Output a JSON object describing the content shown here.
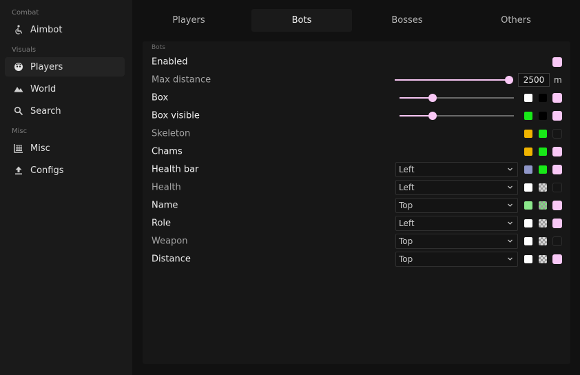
{
  "sidebar": {
    "sections": [
      {
        "label": "Combat",
        "items": [
          {
            "label": "Aimbot",
            "icon": "aimbot-icon",
            "active": false
          }
        ]
      },
      {
        "label": "Visuals",
        "items": [
          {
            "label": "Players",
            "icon": "players-icon",
            "active": true
          },
          {
            "label": "World",
            "icon": "world-icon",
            "active": false
          },
          {
            "label": "Search",
            "icon": "search-icon",
            "active": false
          }
        ]
      },
      {
        "label": "Misc",
        "items": [
          {
            "label": "Misc",
            "icon": "misc-icon",
            "active": false
          },
          {
            "label": "Configs",
            "icon": "upload-icon",
            "active": false
          }
        ]
      }
    ]
  },
  "tabs": [
    {
      "label": "Players",
      "active": false
    },
    {
      "label": "Bots",
      "active": true
    },
    {
      "label": "Bosses",
      "active": false
    },
    {
      "label": "Others",
      "active": false
    }
  ],
  "panel": {
    "title": "Bots",
    "accent": "#f9c8f6",
    "rows": [
      {
        "label": "Enabled",
        "enabled": true
      },
      {
        "label": "Max distance",
        "enabled": false,
        "slider_fraction": 1.0,
        "value": "2500",
        "unit": "m"
      },
      {
        "label": "Box",
        "enabled": true,
        "slider_fraction": 0.29
      },
      {
        "label": "Box visible",
        "enabled": true,
        "slider_fraction": 0.29
      },
      {
        "label": "Skeleton",
        "enabled": false
      },
      {
        "label": "Chams",
        "enabled": true
      },
      {
        "label": "Health bar",
        "enabled": true,
        "select": "Left"
      },
      {
        "label": "Health",
        "enabled": false,
        "select": "Left"
      },
      {
        "label": "Name",
        "enabled": true,
        "select": "Top"
      },
      {
        "label": "Role",
        "enabled": true,
        "select": "Left"
      },
      {
        "label": "Weapon",
        "enabled": false,
        "select": "Top"
      },
      {
        "label": "Distance",
        "enabled": true,
        "select": "Top"
      }
    ],
    "colors": {
      "white": "#ffffff",
      "black": "#000000",
      "green": "#18e818",
      "orange": "#f0b400",
      "lavender": "#8f96c8",
      "lightgreen": "#8be88b",
      "pink": "#f9c8f6"
    }
  }
}
